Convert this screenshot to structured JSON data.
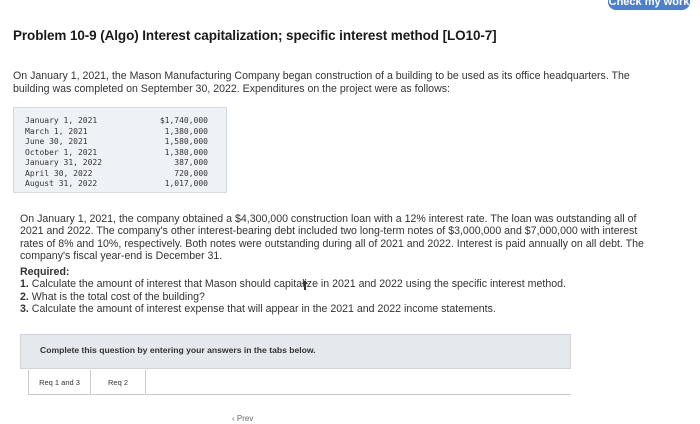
{
  "header": {
    "check_work_label": "Check my work"
  },
  "problem": {
    "title": "Problem 10-9 (Algo) Interest capitalization; specific interest method [LO10-7]",
    "intro": "On January 1, 2021, the Mason Manufacturing Company began construction of a building to be used as its office headquarters. The building was completed on September 30, 2022. Expenditures on the project were as follows:",
    "expenditures": [
      {
        "date": "January 1, 2021",
        "amount": "$1,740,000"
      },
      {
        "date": "March 1, 2021",
        "amount": "1,380,000"
      },
      {
        "date": "June 30, 2021",
        "amount": "1,580,000"
      },
      {
        "date": "October 1, 2021",
        "amount": "1,380,000"
      },
      {
        "date": "January 31, 2022",
        "amount": "387,000"
      },
      {
        "date": "April 30, 2022",
        "amount": "720,000"
      },
      {
        "date": "August 31, 2022",
        "amount": "1,017,000"
      }
    ],
    "loan_paragraph": "On January 1, 2021, the company obtained a $4,300,000 construction loan with a 12% interest rate. The loan was outstanding all of 2021 and 2022. The company's other interest-bearing debt included two long-term notes of $3,000,000 and $7,000,000 with interest rates of 8% and 10%, respectively. Both notes were outstanding during all of 2021 and 2022. Interest is paid annually on all debt. The company's fiscal year-end is December 31.",
    "required_heading": "Required:",
    "required_items": [
      {
        "num": "1.",
        "text": "Calculate the amount of interest that Mason should capitalize in 2021 and 2022 using the specific interest method."
      },
      {
        "num": "2.",
        "text": "What is the total cost of the building?"
      },
      {
        "num": "3.",
        "text": "Calculate the amount of interest expense that will appear in the 2021 and 2022 income statements."
      }
    ]
  },
  "instructions": {
    "text": "Complete this question by entering your answers in the tabs below."
  },
  "tabs": [
    {
      "label": "Req 1 and 3"
    },
    {
      "label": "Req 2"
    }
  ],
  "bottom_nav": {
    "prev_label": "Prev"
  }
}
